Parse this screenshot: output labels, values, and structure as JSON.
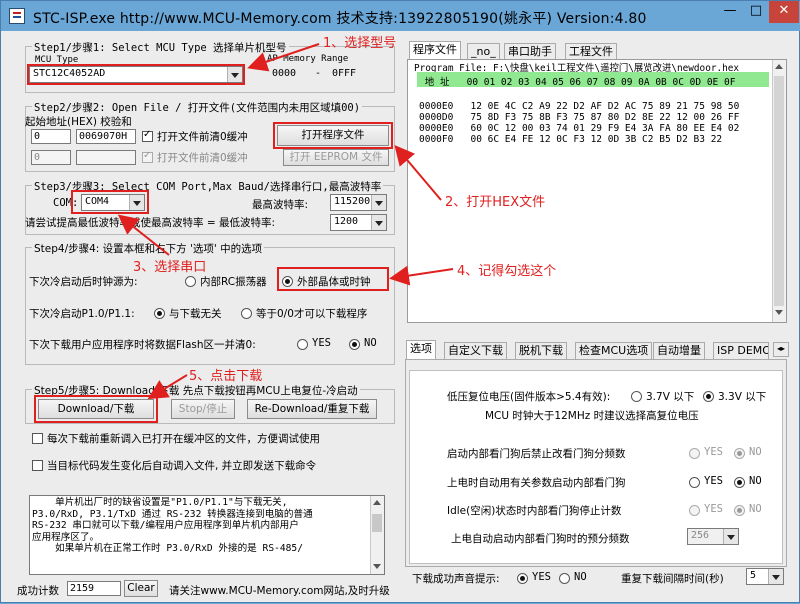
{
  "window": {
    "title": "STC-ISP.exe     http://www.MCU-Memory.com 技术支持:13922805190(姚永平) Version:4.80",
    "min_label": "—",
    "max_label": "□",
    "close_label": "✕"
  },
  "step1": {
    "group_label": "Step1/步骤1: Select MCU Type  选择单片机型号",
    "mcu_type_label": "MCU Type",
    "mcu_value": "STC12C4052AD",
    "ap_label": "AP Memory Range",
    "ap_start": "0000",
    "ap_sep": "-",
    "ap_end": "0FFF"
  },
  "step2": {
    "group_label": "Step2/步骤2: Open File / 打开文件(文件范围内未用区域填00)",
    "addr_label": "起始地址(HEX) 校验和",
    "addr1": "0",
    "checksum1": "0069070H",
    "clear_buffer1": "打开文件前清0缓冲",
    "open_program_button": "打开程序文件",
    "addr2": "0",
    "checksum2": "",
    "clear_buffer2": "打开文件前清0缓冲",
    "open_eeprom_button": "打开 EEPROM 文件"
  },
  "step3": {
    "group_label": "Step3/步骤3: Select COM Port,Max Baud/选择串行口,最高波特率",
    "com_label": "COM:",
    "com_value": "COM4",
    "max_baud_label": "最高波特率:",
    "max_baud_value": "115200",
    "try_label": "请尝试提高最低波特率或使最高波特率 =  最低波特率:",
    "min_baud_value": "1200"
  },
  "step4": {
    "group_label": "Step4/步骤4: 设置本框和右下方 '选项' 中的选项",
    "clock_label": "下次冷启动后时钟源为:",
    "clock_internal": "内部RC振荡器",
    "clock_external": "外部晶体或时钟",
    "p1_label": "下次冷启动P1.0/P1.1:",
    "p1_opt1": "与下载无关",
    "p1_opt2": "等于0/0才可以下载程序",
    "flash_label": "下次下载用户应用程序时将数据Flash区一并清0:",
    "yes": "YES",
    "no": "NO"
  },
  "step5": {
    "group_label": "Step5/步骤5: Download/下载   先点下载按钮再MCU上电复位-冷启动",
    "download_button": "Download/下载",
    "stop_button": "Stop/停止",
    "redownload_button": "Re-Download/重复下载",
    "check1": "每次下载前重新调入已打开在缓冲区的文件，方便调试使用",
    "check2": "当目标代码发生变化后自动调入文件, 并立即发送下载命令",
    "info_text": "    单片机出厂时的缺省设置是\"P1.0/P1.1\"与下载无关,\nP3.0/RxD, P3.1/TxD 通过 RS-232 转换器连接到电脑的普通\nRS-232 串口就可以下载/编程用户应用程序到单片机内部用户\n应用程序区了。\n    如果单片机在正常工作时 P3.0/RxD 外接的是 RS-485/"
  },
  "status": {
    "count_label": "成功计数",
    "count_value": "2159",
    "clear_button": "Clear",
    "note": "请关注www.MCU-Memory.com网站,及时升级"
  },
  "top_tabs": [
    "程序文件",
    "_no_",
    "串口助手",
    "工程文件"
  ],
  "program_file": "Program File: F:\\快盘\\keil工程文件\\遥控门\\展览改进\\newdoor.hex",
  "hex": {
    "header": " 地 址   00 01 02 03 04 05 06 07 08 09 0A 0B 0C 0D 0E 0F",
    "rows": [
      "0000E0   12 0E 4C C2 A9 22 D2 AF D2 AC 75 89 21 75 98 50",
      "0000D0   75 8D F3 75 8B F3 75 87 80 D2 8E 22 12 00 26 FF",
      "0000E0   60 0C 12 00 03 74 01 29 F9 E4 3A FA 80 EE E4 02",
      "0000F0   00 6C E4 FE 12 0C F3 12 0D 3B C2 B5 D2 B3 22"
    ]
  },
  "bottom_tabs": [
    "选项",
    "自定义下载",
    "脱机下载",
    "检查MCU选项",
    "自动增量",
    "ISP DEMO"
  ],
  "options": {
    "lvr_label": "低压复位电压(固件版本>5.4有效):",
    "lvr_opt1": "3.7V 以下",
    "lvr_opt2": "3.3V 以下",
    "clock_note": "MCU 时钟大于12MHz 时建议选择高复位电压",
    "wdt1": "启动内部看门狗后禁止改看门狗分频数",
    "wdt2": "上电时自动用有关参数启动内部看门狗",
    "wdt3": "Idle(空闲)状态时内部看门狗停止计数",
    "wdt4": "上电自动启动内部看门狗时的预分频数",
    "wdt_prescale": "256",
    "yes": "YES",
    "no": "NO"
  },
  "bottom_bar": {
    "sound_label": "下载成功声音提示:",
    "yes": "YES",
    "no": "NO",
    "interval_label": "重复下载间隔时间(秒)",
    "interval_value": "5"
  },
  "annotations": {
    "a1": "1、选择型号",
    "a2": "2、打开HEX文件",
    "a3": "3、选择串口",
    "a4": "4、记得勾选这个",
    "a5": "5、点击下载"
  },
  "colors": {
    "titlebar": "#6aa6d6",
    "annotation": "#e0201f",
    "hex_header": "#90e890"
  }
}
